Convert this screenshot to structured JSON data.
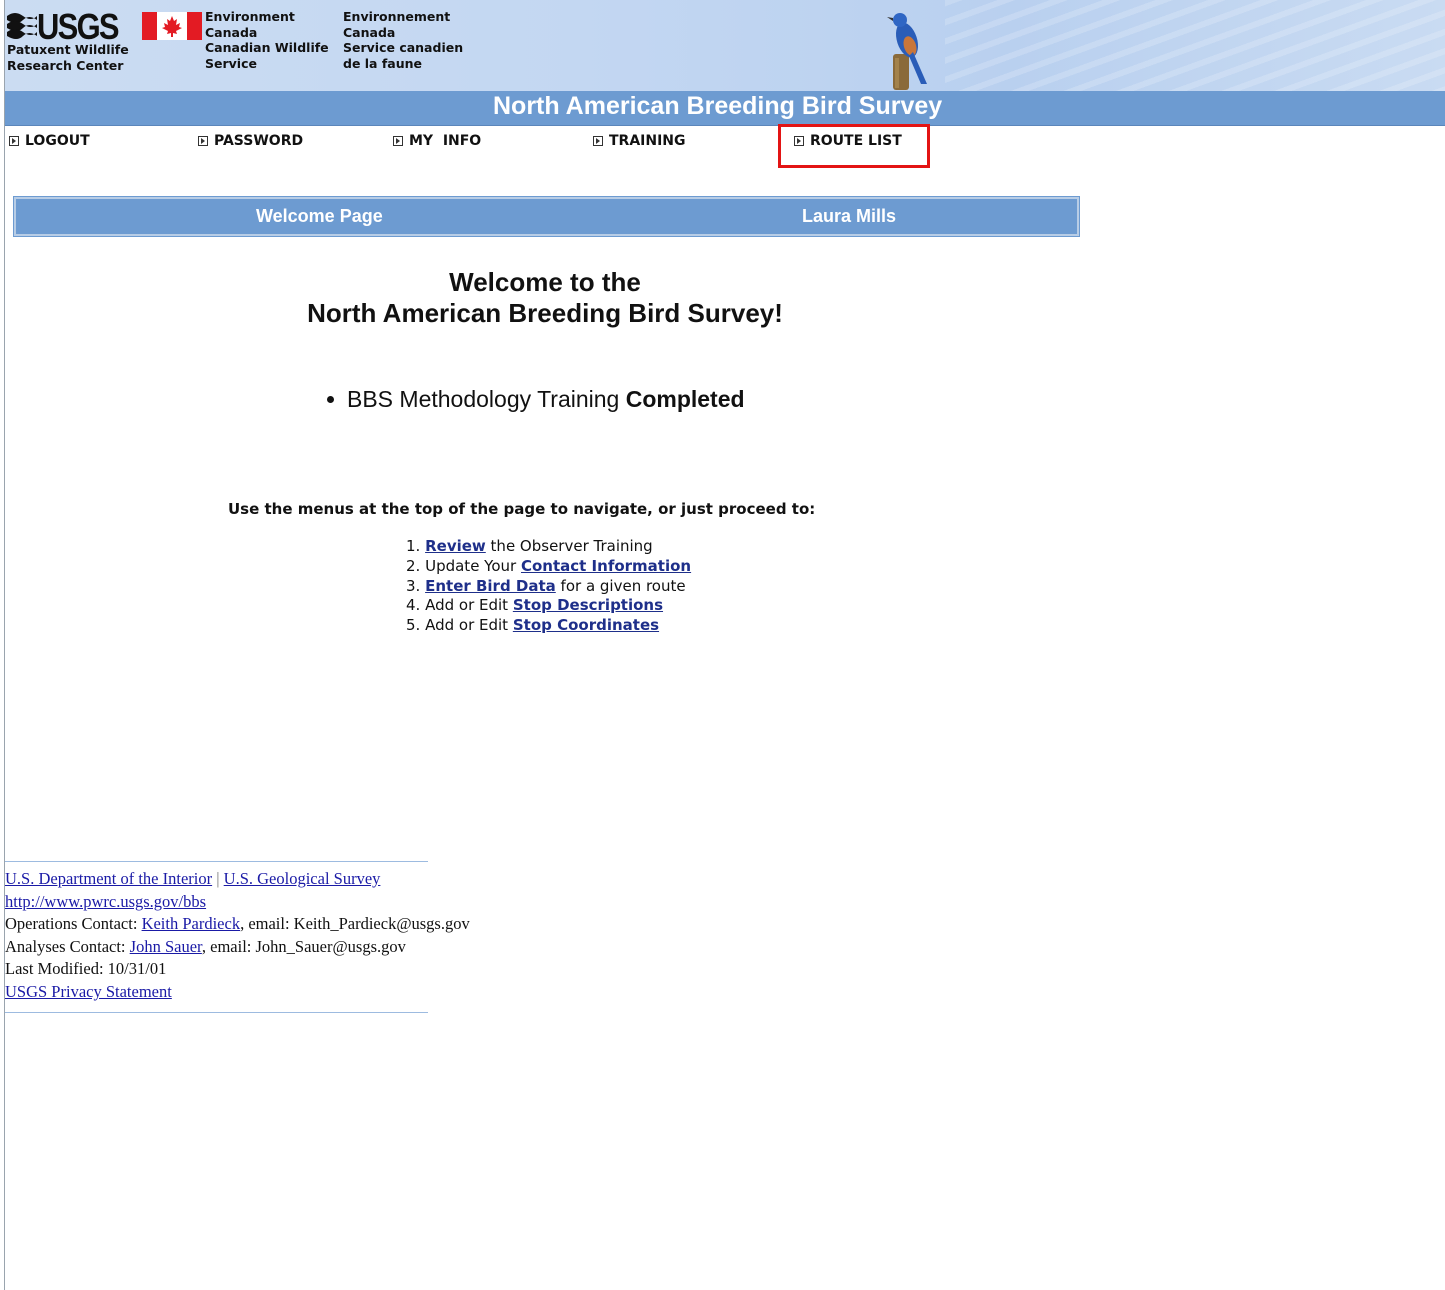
{
  "banner": {
    "usgs_logo_text": "USGS",
    "usgs_subtitle": "Patuxent Wildlife\nResearch Center",
    "ec_english_lines": [
      "Environment",
      "Canada",
      "Canadian Wildlife",
      "Service"
    ],
    "ec_french_lines": [
      "Environnement",
      "Canada",
      "Service canadien",
      "de la faune"
    ]
  },
  "site_title": "North American Breeding Bird Survey",
  "nav": {
    "logout": "LOGOUT",
    "password": "PASSWORD",
    "my_info": "MY  INFO",
    "training": "TRAINING",
    "route_list": "ROUTE LIST"
  },
  "welcome_bar": {
    "page_label": "Welcome Page",
    "user_name": "Laura Mills"
  },
  "headline": {
    "line1": "Welcome to the",
    "line2": "North American Breeding Bird Survey!"
  },
  "training_status": {
    "label": "BBS Methodology Training",
    "status": "Completed"
  },
  "instruction": "Use the menus at the top of the page to navigate, or just proceed to:",
  "steps": [
    {
      "num": "1.",
      "pre": "",
      "link": "Review",
      "post": " the Observer Training"
    },
    {
      "num": "2.",
      "pre": "Update Your ",
      "link": "Contact Information",
      "post": ""
    },
    {
      "num": "3.",
      "pre": "",
      "link": "Enter Bird Data",
      "post": " for a given route"
    },
    {
      "num": "4.",
      "pre": "Add or Edit ",
      "link": "Stop Descriptions",
      "post": ""
    },
    {
      "num": "5.",
      "pre": "Add or Edit ",
      "link": "Stop Coordinates",
      "post": ""
    }
  ],
  "footer": {
    "doi_link": "U.S. Department of the Interior",
    "separator": "|",
    "usgs_link": "U.S. Geological Survey",
    "site_url": "http://www.pwrc.usgs.gov/bbs",
    "ops_label": "Operations Contact: ",
    "ops_name": "Keith Pardieck",
    "ops_email": ", email: Keith_Pardieck@usgs.gov",
    "analyses_label": "Analyses Contact: ",
    "analyses_name": "John Sauer",
    "analyses_email": ", email: John_Sauer@usgs.gov",
    "last_modified": "Last Modified: 10/31/01",
    "privacy_link": "USGS Privacy Statement"
  },
  "colors": {
    "banner_bg": "#c3d7f2",
    "title_bar": "#6d9bd1",
    "link_blue": "#1e2f8a",
    "highlight_red": "#e31414"
  }
}
